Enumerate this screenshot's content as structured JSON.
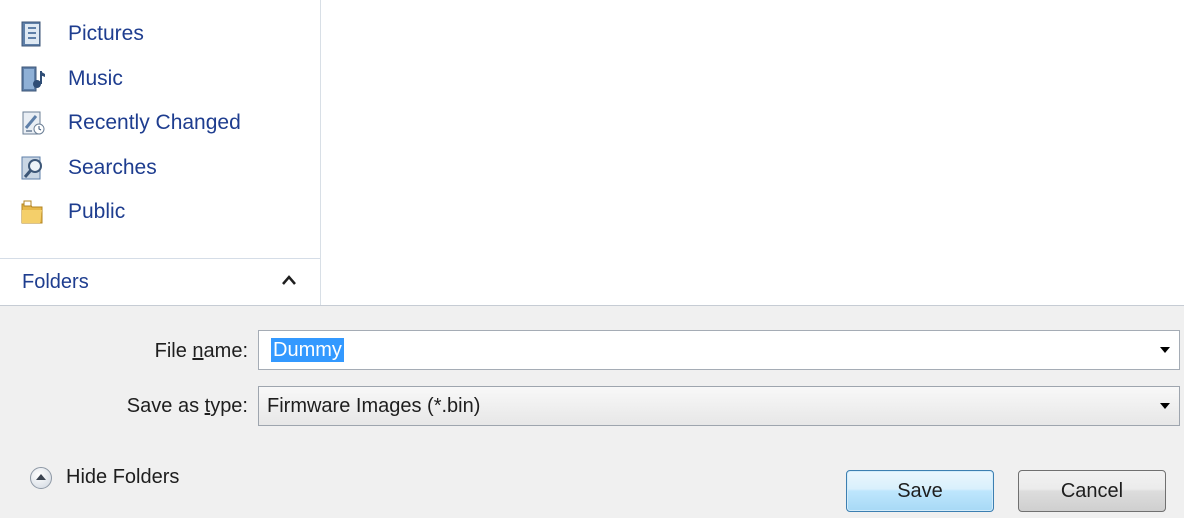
{
  "nav": {
    "items": [
      {
        "label": "Pictures",
        "icon": "pictures-library-icon"
      },
      {
        "label": "Music",
        "icon": "music-library-icon"
      },
      {
        "label": "Recently Changed",
        "icon": "recently-changed-icon"
      },
      {
        "label": "Searches",
        "icon": "searches-icon"
      },
      {
        "label": "Public",
        "icon": "public-folder-icon"
      }
    ],
    "folders_header": "Folders"
  },
  "form": {
    "file_name_label_pre": "File ",
    "file_name_label_accel": "n",
    "file_name_label_post": "ame:",
    "file_name_value": "Dummy",
    "save_type_label_pre": "Save as ",
    "save_type_label_accel": "t",
    "save_type_label_post": "ype:",
    "save_type_value": "Firmware Images (*.bin)"
  },
  "footer": {
    "hide_folders_label": "Hide Folders",
    "save_label": "Save",
    "cancel_label": "Cancel"
  },
  "colors": {
    "link_blue": "#1e3d8f",
    "selection": "#3399ff",
    "panel_bg": "#f0f0f0"
  }
}
